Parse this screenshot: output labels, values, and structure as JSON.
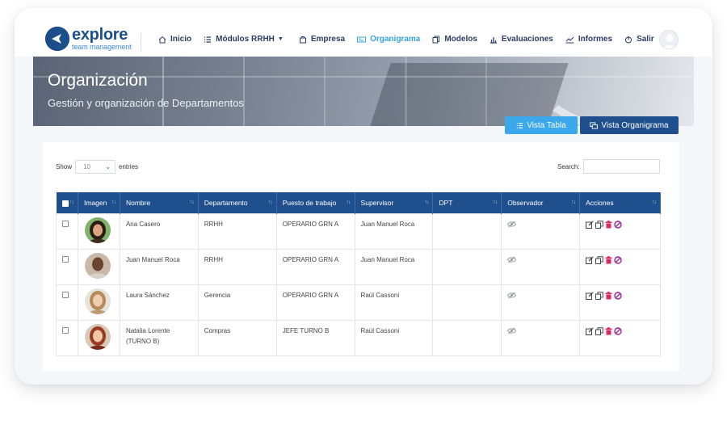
{
  "brand": {
    "name": "explore",
    "tagline": "team management",
    "color": "#1a4f8b",
    "accent": "#3c8ad6"
  },
  "nav": {
    "items": [
      {
        "label": "Inicio",
        "icon": "home-icon",
        "active": false
      },
      {
        "label": "Módulos RRHH",
        "icon": "list-icon",
        "active": false,
        "dropdown": true
      },
      {
        "label": "Empresa",
        "icon": "building-icon",
        "active": false
      },
      {
        "label": "Organigrama",
        "icon": "org-card-icon",
        "active": true
      },
      {
        "label": "Modelos",
        "icon": "copy-icon",
        "active": false
      },
      {
        "label": "Evaluaciones",
        "icon": "bar-chart-icon",
        "active": false
      },
      {
        "label": "Informes",
        "icon": "line-chart-icon",
        "active": false
      },
      {
        "label": "Salir",
        "icon": "power-icon",
        "active": false
      }
    ],
    "active_color": "#36a3e0"
  },
  "banner": {
    "title": "Organización",
    "subtitle": "Gestión y organización de Departamentos"
  },
  "view_buttons": {
    "table": "Vista Tabla",
    "org": "Vista Organigrama"
  },
  "table_controls": {
    "show_label": "Show",
    "entries_value": "10",
    "entries_label": "entries",
    "search_label": "Search:"
  },
  "table": {
    "columns": [
      "Imagen",
      "Nombre",
      "Departamento",
      "Puesto de trabajo",
      "Supervisor",
      "DPT",
      "Observador",
      "Acciones"
    ],
    "rows": [
      {
        "nombre": "Ana Casero",
        "departamento": "RRHH",
        "puesto": "OPERARIO GRN A",
        "supervisor": "Juan Manuel Roca",
        "dpt": "",
        "photo": "woman-dark-hair"
      },
      {
        "nombre": "Juan Manuel Roca",
        "departamento": "RRHH",
        "puesto": "OPERARIO GRN A",
        "supervisor": "Juan Manuel Roca",
        "dpt": "",
        "photo": "man-bald"
      },
      {
        "nombre": "Laura Sánchez",
        "departamento": "Gerencia",
        "puesto": "OPERARIO GRN A",
        "supervisor": "Raúl Cassoni",
        "dpt": "",
        "photo": "woman-light-hair"
      },
      {
        "nombre": "Natalia Lorente (TURNO B)",
        "departamento": "Compras",
        "puesto": "JEFE TURNO B",
        "supervisor": "Raúl Cassoni",
        "dpt": "",
        "photo": "woman-red-hair"
      }
    ]
  },
  "colors": {
    "header_bg": "#1f4f8c",
    "btn_table": "#3ba8eb",
    "btn_org": "#1f4f8c",
    "delete": "#e0245e",
    "block": "#a020a0"
  }
}
